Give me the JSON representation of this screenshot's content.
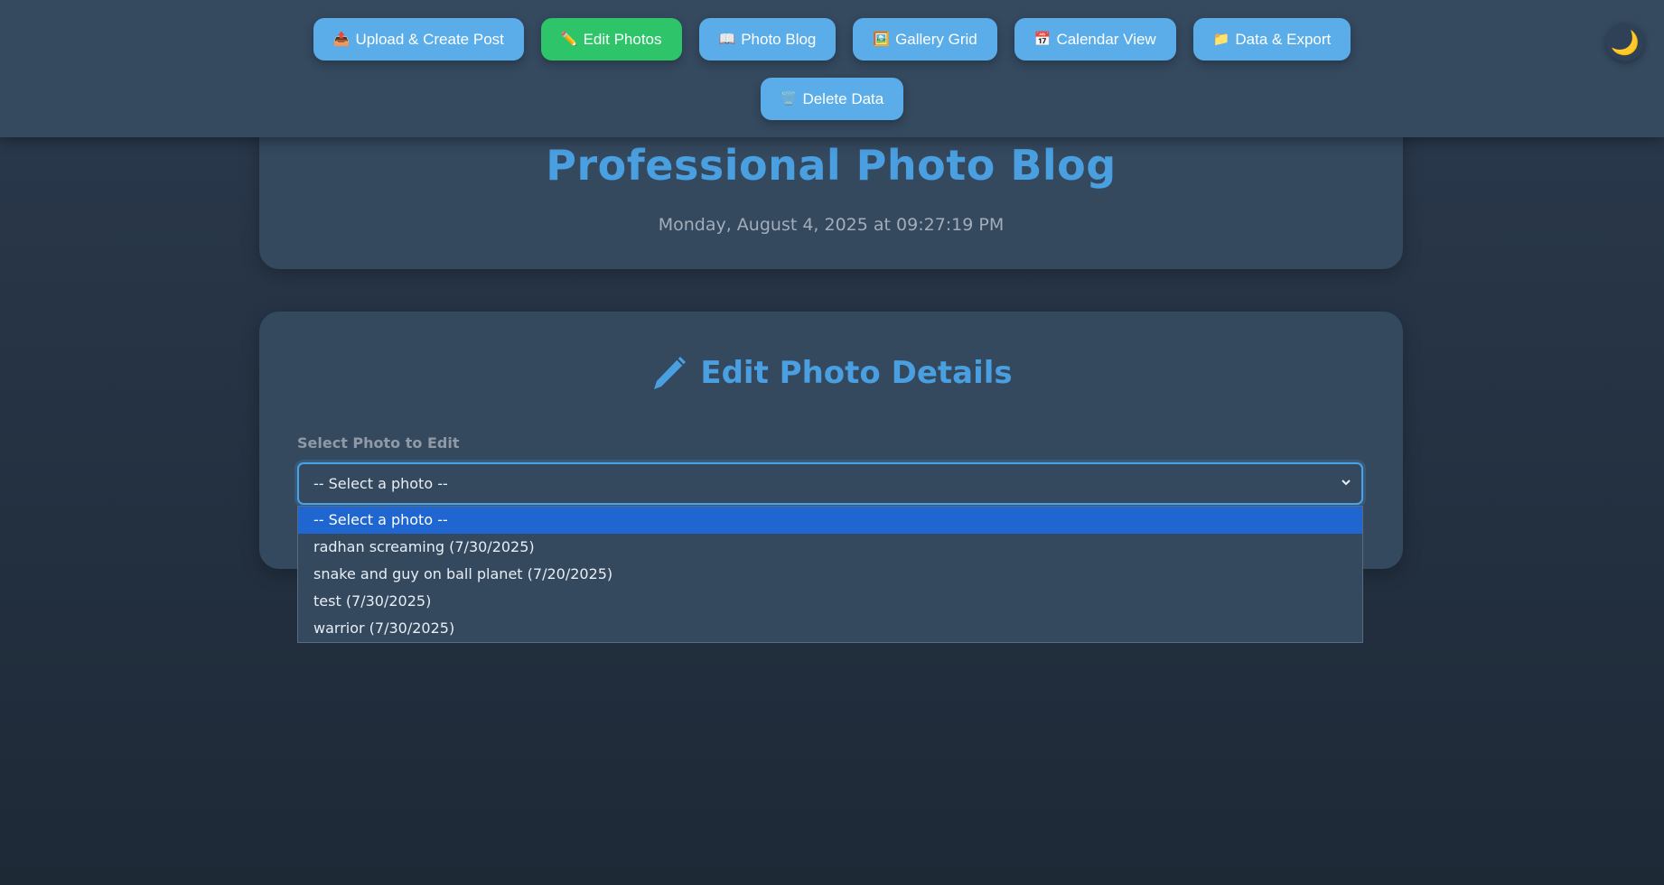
{
  "nav": {
    "buttons": [
      {
        "icon": "📤",
        "label": "Upload & Create Post"
      },
      {
        "icon": "✏️",
        "label": "Edit Photos"
      },
      {
        "icon": "📖",
        "label": "Photo Blog"
      },
      {
        "icon": "🖼️",
        "label": "Gallery Grid"
      },
      {
        "icon": "📅",
        "label": "Calendar View"
      },
      {
        "icon": "📁",
        "label": "Data & Export"
      },
      {
        "icon": "🗑️",
        "label": "Delete Data"
      }
    ],
    "active": "Edit Photos",
    "theme_icon": "🌙"
  },
  "header": {
    "title": "Professional Photo Blog",
    "datetime": "Monday, August 4, 2025 at 09:27:19 PM"
  },
  "edit": {
    "title": "Edit Photo Details",
    "select_label": "Select Photo to Edit",
    "selected_value": "-- Select a photo --",
    "options": [
      "-- Select a photo --",
      "radhan screaming (7/30/2025)",
      "snake and guy on ball planet (7/20/2025)",
      "test (7/30/2025)",
      "warrior (7/30/2025)"
    ]
  },
  "colors": {
    "accent": "#4a9fe0",
    "button": "#5aade8",
    "active_button": "#2ec56a",
    "card": "#34485e",
    "selected_option": "#1f66d1"
  }
}
